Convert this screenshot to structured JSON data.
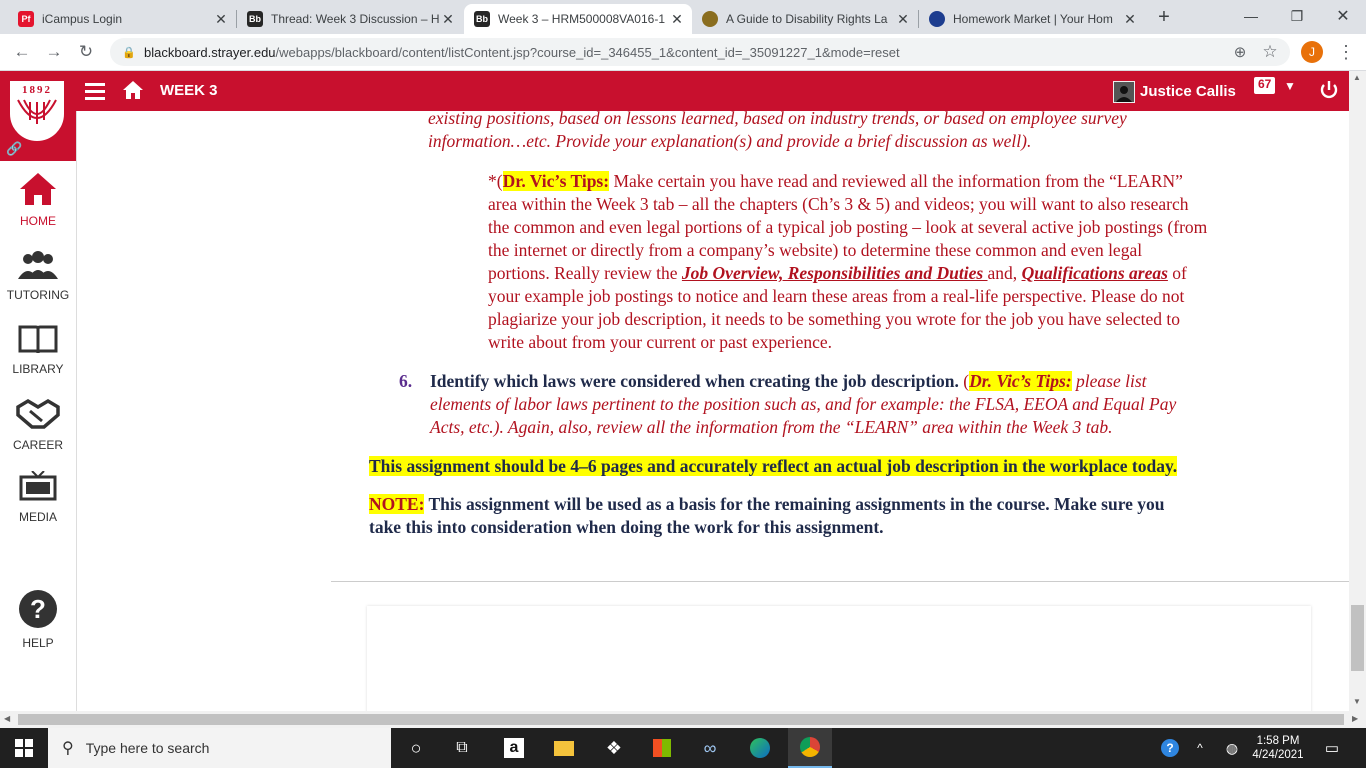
{
  "browser": {
    "tabs": [
      {
        "title": "iCampus Login",
        "favicon": "Pf",
        "favicon_color": "#e4142e",
        "active": false
      },
      {
        "title": "Thread: Week 3 Discussion – H",
        "favicon": "Bb",
        "favicon_color": "#262626",
        "active": false
      },
      {
        "title": "Week 3 – HRM500008VA016-1",
        "favicon": "Bb",
        "favicon_color": "#262626",
        "active": true
      },
      {
        "title": "A Guide to Disability Rights La",
        "favicon": "seal",
        "favicon_color": "#8a6d1f",
        "active": false
      },
      {
        "title": "Homework Market | Your Hom",
        "favicon": "hm",
        "favicon_color": "#1d3d8f",
        "active": false
      }
    ],
    "url_host": "blackboard.strayer.edu",
    "url_path": "/webapps/blackboard/content/listContent.jsp?course_id=_346455_1&content_id=_35091227_1&mode=reset",
    "profile_initial": "J",
    "profile_color": "#e8710a"
  },
  "bb": {
    "logo_year": "1892",
    "title": "WEEK 3",
    "user_name": "Justice Callis",
    "notification_count": "67",
    "brand_color": "#c8102e"
  },
  "sidebar": {
    "items": [
      {
        "label": "HOME"
      },
      {
        "label": "TUTORING"
      },
      {
        "label": "LIBRARY"
      },
      {
        "label": "CAREER"
      },
      {
        "label": "MEDIA"
      },
      {
        "label": "HELP"
      }
    ]
  },
  "content": {
    "top_line1": "existing positions, based on lessons learned, based on industry trends, or based on employee survey",
    "top_line2": "information…etc. Provide your explanation(s) and provide a brief discussion as well).",
    "tip1_prefix": "*(",
    "tip1_label": "Dr. Vic’s Tips:",
    "tip1_l1": " Make certain you have read and reviewed all the information from the “LEARN”",
    "tip1_l2": "area within the Week 3 tab – all the chapters (Ch’s 3 & 5) and videos; you will want to also research",
    "tip1_l3": "the common and even legal portions of a typical job posting – look at several active job postings (from",
    "tip1_l4": "the internet or directly from a company’s website) to determine these common and even legal",
    "tip1_l5a": "portions. Really review the ",
    "tip1_l5b": "Job Overview, Responsibilities and Duties ",
    "tip1_l5c": "and, ",
    "tip1_l5d": "Qualifications areas",
    "tip1_l5e": " of",
    "tip1_l6": "your example job postings to notice and learn these areas from a real-life perspective. Please do not",
    "tip1_l7": "plagiarize your job description, it needs to be something you wrote for the job you have selected to",
    "tip1_l8": "write about from your current or past experience.",
    "item6_number": "6.",
    "item6_bold": "Identify which laws were considered when creating the job description.",
    "item6_paren": " (",
    "item6_tip_label": "Dr. Vic’s Tips:",
    "item6_tip_l1": " please list",
    "item6_tip_l2": "elements of labor laws pertinent to the position such as, and for example: the FLSA, EEOA and Equal Pay",
    "item6_tip_l3": "Acts, etc.). Again, also, review all the information from the “LEARN” area within the Week 3 tab.",
    "assignment_note": "This assignment should be 4–6 pages and accurately reflect an actual job description in the workplace today.",
    "note_label": "NOTE:",
    "note_l1": " This assignment will be used as a basis for the remaining assignments in the course. Make sure you",
    "note_l2": "take this into consideration when doing the work for this assignment."
  },
  "taskbar": {
    "search_placeholder": "Type here to search",
    "time": "1:58 PM",
    "date": "4/24/2021"
  }
}
